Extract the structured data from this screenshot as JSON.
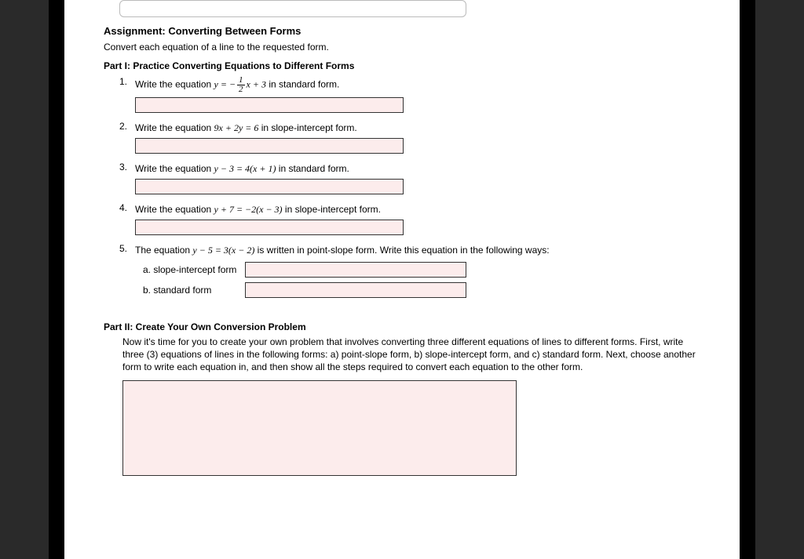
{
  "assignment_title": "Assignment: Converting Between Forms",
  "intro": "Convert each equation of a line to the requested form.",
  "part1": {
    "title": "Part I: Practice Converting Equations to Different Forms",
    "items": [
      {
        "num": "1.",
        "prefix": "Write the equation ",
        "eq_pre": "y = −",
        "frac_num": "1",
        "frac_den": "2",
        "eq_post": "x + 3",
        "suffix": " in standard form."
      },
      {
        "num": "2.",
        "prefix": "Write the equation ",
        "eq": "9x + 2y = 6",
        "suffix": " in slope-intercept form."
      },
      {
        "num": "3.",
        "prefix": "Write the equation ",
        "eq": "y − 3 = 4(x + 1)",
        "suffix": " in standard form."
      },
      {
        "num": "4.",
        "prefix": "Write the equation ",
        "eq": "y + 7 = −2(x − 3)",
        "suffix": " in slope-intercept form."
      },
      {
        "num": "5.",
        "prefix": "The equation ",
        "eq": "y − 5 = 3(x − 2)",
        "suffix": " is written in point-slope form. Write this equation in the following ways:",
        "sub": [
          {
            "label": "a. slope-intercept form"
          },
          {
            "label": "b. standard form"
          }
        ]
      }
    ]
  },
  "part2": {
    "title": "Part II: Create Your Own Conversion Problem",
    "desc": "Now it's time for you to create your own problem that involves converting three different equations of lines to different forms. First, write three (3) equations of lines in the following forms: a) point-slope form, b) slope-intercept form, and c) standard form. Next, choose another form to write each equation in, and then show all the steps required to convert each equation to the other form."
  }
}
